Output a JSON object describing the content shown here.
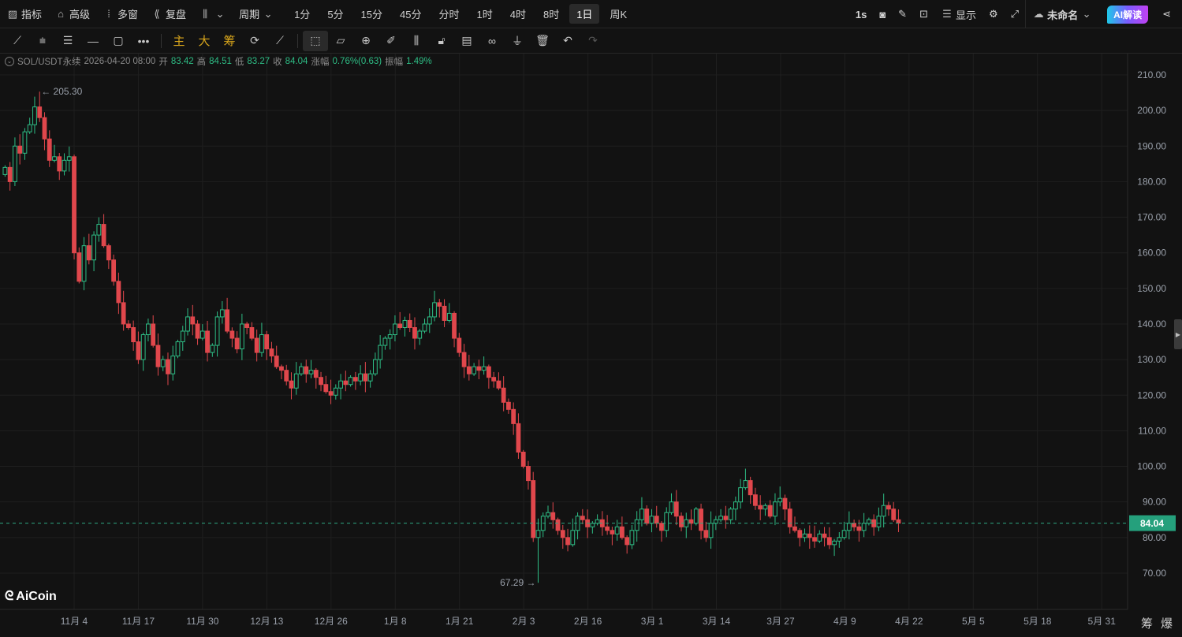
{
  "topbar": {
    "left": [
      {
        "icon": "indicator-icon",
        "label": "指标"
      },
      {
        "icon": "advanced-icon",
        "label": "高级"
      },
      {
        "icon": "multi-window-icon",
        "label": "多窗"
      },
      {
        "icon": "replay-icon",
        "label": "复盘"
      }
    ],
    "period_label": "周期",
    "periods": [
      "1分",
      "5分",
      "15分",
      "45分",
      "分时",
      "1时",
      "4时",
      "8时",
      "1日",
      "周K"
    ],
    "active_period": "1日",
    "right": {
      "interval": "1s",
      "display": "显示",
      "layout_name": "未命名",
      "ai": "AI解读"
    }
  },
  "toolbar": {
    "main": "主",
    "big": "大",
    "chip": "筹"
  },
  "info": {
    "symbol": "SOL/USDT永续",
    "datetime": "2026-04-20 08:00",
    "open_l": "开",
    "open": "83.42",
    "high_l": "高",
    "high": "84.51",
    "low_l": "低",
    "low": "83.27",
    "close_l": "收",
    "close": "84.04",
    "change_l": "涨幅",
    "change": "0.76%(0.63)",
    "amp_l": "振幅",
    "amp": "1.49%"
  },
  "logo": "AiCoin",
  "bottom": {
    "chip": "筹",
    "burst": "爆"
  },
  "chart_data": {
    "type": "candlestick",
    "symbol": "SOL/USDT永续",
    "start_date": "2025-10-21",
    "closes": [
      184,
      180,
      190,
      188,
      194,
      196,
      201,
      198,
      192,
      186,
      187,
      183,
      186,
      187,
      160,
      152,
      162,
      158,
      165,
      168,
      162,
      158,
      152,
      146,
      140,
      139,
      135,
      130,
      137,
      140,
      134,
      128,
      130,
      126,
      131,
      135,
      138,
      142,
      140,
      136,
      138,
      132,
      134,
      142,
      144,
      138,
      136,
      133,
      140,
      139,
      136,
      132,
      137,
      133,
      131,
      128,
      127,
      124,
      122,
      126,
      128,
      126,
      127,
      125,
      123,
      121,
      120,
      122,
      124,
      123,
      125,
      124,
      126,
      124,
      126,
      130,
      134,
      136,
      137,
      140,
      139,
      141,
      139,
      136,
      138,
      140,
      142,
      146,
      145,
      141,
      143,
      136,
      132,
      128,
      126,
      128,
      127,
      128,
      125,
      124,
      122,
      118,
      116,
      112,
      104,
      100,
      96,
      80,
      82,
      86,
      87,
      85,
      82,
      80,
      78,
      82,
      86,
      85,
      83,
      84,
      85,
      83,
      82,
      81,
      83,
      80,
      78,
      82,
      85,
      88,
      84,
      86,
      84,
      82,
      87,
      90,
      86,
      83,
      85,
      84,
      88,
      82,
      80,
      84,
      85,
      86,
      85,
      88,
      90,
      94,
      96,
      92,
      89,
      88,
      89,
      86,
      90,
      91,
      88,
      83,
      82,
      80,
      81,
      80,
      79,
      81,
      80,
      78,
      79,
      80,
      82,
      84,
      83,
      82,
      84,
      85,
      83,
      86,
      89,
      88,
      85,
      84.04
    ],
    "max_marker": {
      "value": "205.30",
      "index": 7
    },
    "min_marker": {
      "value": "67.29",
      "index": 108
    },
    "last_price": "84.04",
    "y_ticks": [
      "210.00",
      "200.00",
      "190.00",
      "180.00",
      "170.00",
      "160.00",
      "150.00",
      "140.00",
      "130.00",
      "120.00",
      "110.00",
      "100.00",
      "90.00",
      "80.00",
      "70.00"
    ],
    "x_ticks": [
      "11月 4",
      "11月 17",
      "11月 30",
      "12月 13",
      "12月 26",
      "1月 8",
      "1月 21",
      "2月 3",
      "2月 16",
      "3月 1",
      "3月 14",
      "3月 27",
      "4月 9",
      "4月 22",
      "5月 5",
      "5月 18",
      "5月 31"
    ],
    "colors": {
      "up": "#2ebd85",
      "down": "#e0474c",
      "grid": "#1f1f1f"
    }
  }
}
